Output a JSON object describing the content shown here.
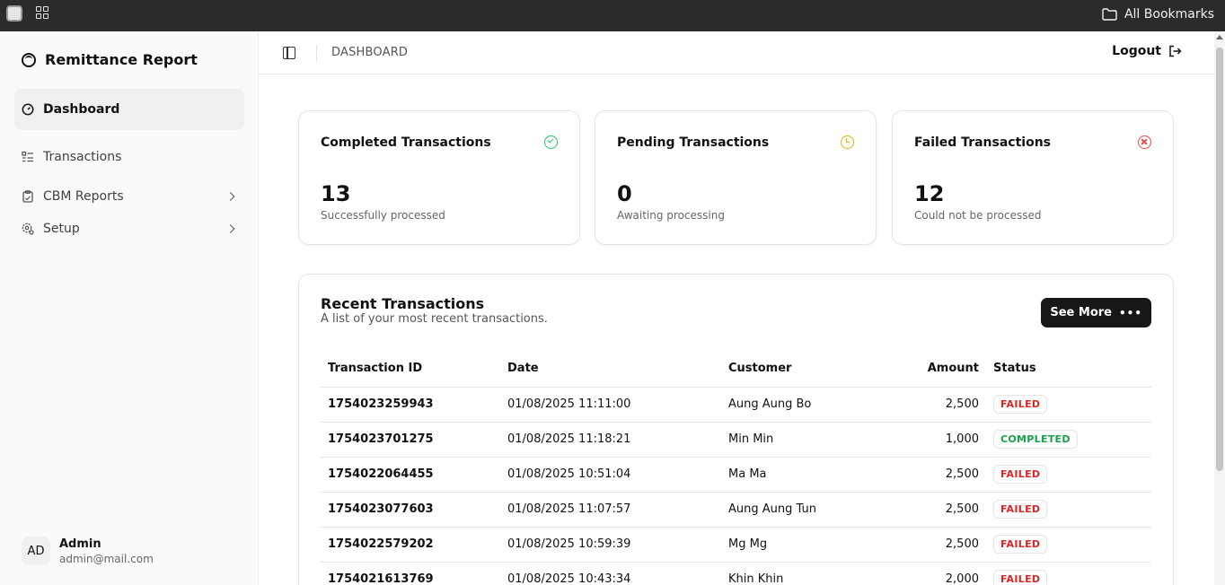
{
  "browser": {
    "bookmarks_label": "All Bookmarks"
  },
  "sidebar": {
    "brand": "Remittance Report",
    "items": [
      {
        "label": "Dashboard",
        "icon": "gauge-icon",
        "active": true
      },
      {
        "label": "Transactions",
        "icon": "list-icon"
      },
      {
        "label": "CBM Reports",
        "icon": "clipboard-icon",
        "expandable": true
      },
      {
        "label": "Setup",
        "icon": "settings-icon",
        "expandable": true
      }
    ],
    "user": {
      "initials": "AD",
      "name": "Admin",
      "email": "admin@mail.com"
    }
  },
  "header": {
    "breadcrumb": "DASHBOARD",
    "logout_label": "Logout"
  },
  "stats": [
    {
      "title": "Completed Transactions",
      "value": "13",
      "subtitle": "Successfully processed",
      "icon": "check-circle-icon",
      "color": "#22c55e"
    },
    {
      "title": "Pending Transactions",
      "value": "0",
      "subtitle": "Awaiting processing",
      "icon": "clock-icon",
      "color": "#eab308"
    },
    {
      "title": "Failed Transactions",
      "value": "12",
      "subtitle": "Could not be processed",
      "icon": "x-circle-icon",
      "color": "#ef4444"
    }
  ],
  "recent": {
    "title": "Recent Transactions",
    "description": "A list of your most recent transactions.",
    "see_more_label": "See More",
    "columns": [
      "Transaction ID",
      "Date",
      "Customer",
      "Amount",
      "Status"
    ],
    "rows": [
      {
        "id": "1754023259943",
        "date": "01/08/2025 11:11:00",
        "customer": "Aung Aung Bo",
        "amount": "2,500",
        "status": "FAILED"
      },
      {
        "id": "1754023701275",
        "date": "01/08/2025 11:18:21",
        "customer": "Min Min",
        "amount": "1,000",
        "status": "COMPLETED"
      },
      {
        "id": "1754022064455",
        "date": "01/08/2025 10:51:04",
        "customer": "Ma Ma",
        "amount": "2,500",
        "status": "FAILED"
      },
      {
        "id": "1754023077603",
        "date": "01/08/2025 11:07:57",
        "customer": "Aung Aung Tun",
        "amount": "2,500",
        "status": "FAILED"
      },
      {
        "id": "1754022579202",
        "date": "01/08/2025 10:59:39",
        "customer": "Mg Mg",
        "amount": "2,500",
        "status": "FAILED"
      },
      {
        "id": "1754021613769",
        "date": "01/08/2025 10:43:34",
        "customer": "Khin Khin",
        "amount": "2,000",
        "status": "FAILED"
      }
    ]
  }
}
